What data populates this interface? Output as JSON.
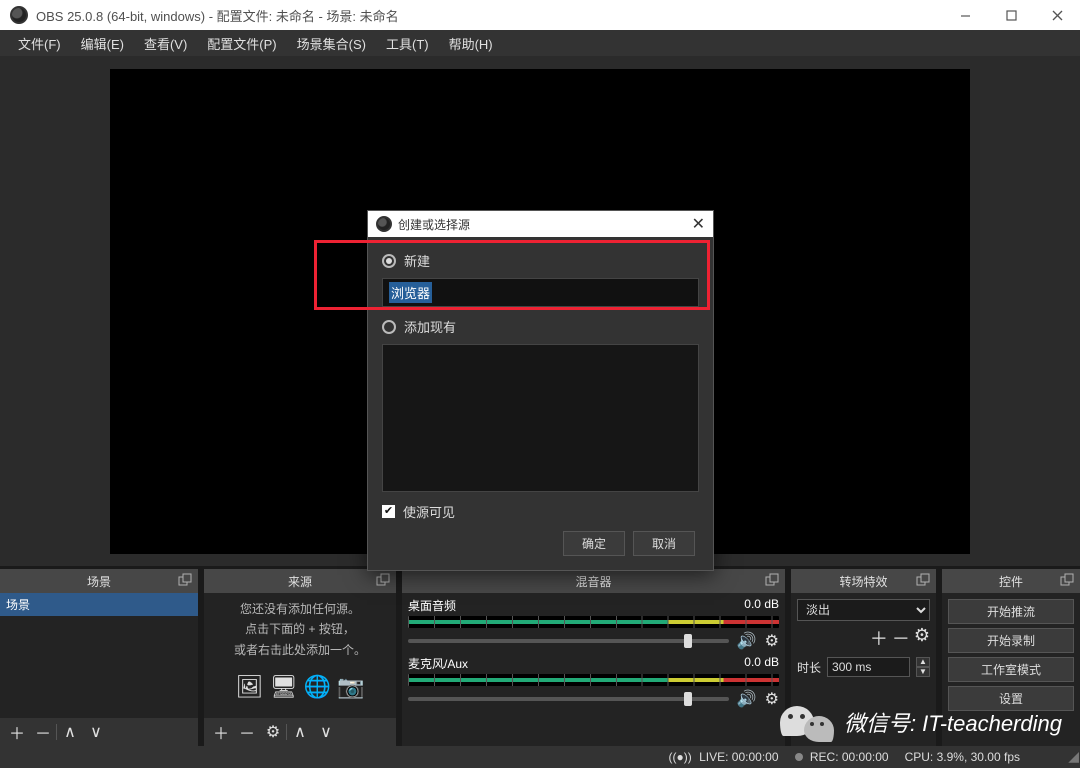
{
  "window": {
    "title": "OBS 25.0.8 (64-bit, windows) - 配置文件: 未命名 - 场景: 未命名"
  },
  "menu": {
    "items": [
      "文件(F)",
      "编辑(E)",
      "查看(V)",
      "配置文件(P)",
      "场景集合(S)",
      "工具(T)",
      "帮助(H)"
    ]
  },
  "docks": {
    "scenes": {
      "title": "场景",
      "item": "场景"
    },
    "sources": {
      "title": "来源",
      "empty_lines": [
        "您还没有添加任何源。",
        "点击下面的 + 按钮，",
        "或者右击此处添加一个。"
      ]
    },
    "mixer": {
      "title": "混音器",
      "channels": [
        {
          "name": "桌面音频",
          "db": "0.0 dB",
          "thumb_pct": 86
        },
        {
          "name": "麦克风/Aux",
          "db": "0.0 dB",
          "thumb_pct": 86
        }
      ]
    },
    "transitions": {
      "title": "转场特效",
      "selected": "淡出",
      "duration_label": "时长",
      "duration_value": "300 ms"
    },
    "controls": {
      "title": "控件",
      "buttons": [
        "开始推流",
        "开始录制",
        "工作室模式",
        "设置"
      ]
    }
  },
  "status": {
    "live_label": "LIVE:",
    "live_time": "00:00:00",
    "rec_label": "REC:",
    "rec_time": "00:00:00",
    "cpu": "CPU: 3.9%, 30.00 fps"
  },
  "modal": {
    "title": "创建或选择源",
    "opt_new": "新建",
    "name_value": "浏览器",
    "opt_existing": "添加现有",
    "visible_label": "使源可见",
    "ok": "确定",
    "cancel": "取消"
  },
  "watermark": {
    "text": "微信号: IT-teacherding"
  }
}
